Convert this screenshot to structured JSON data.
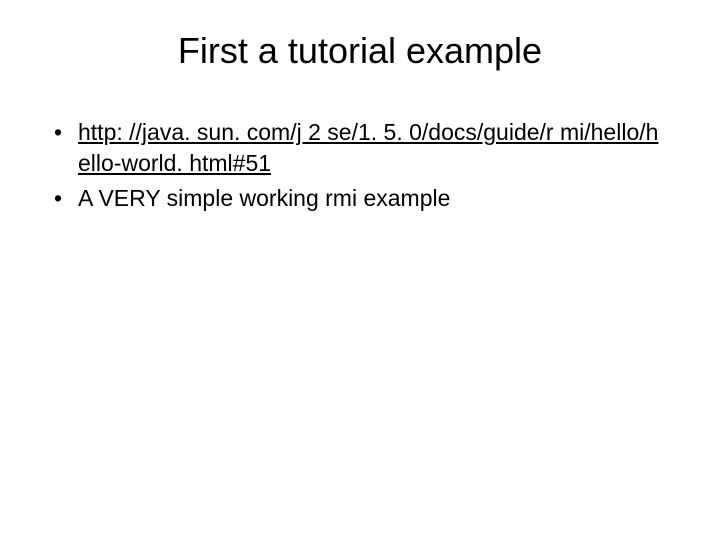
{
  "title": "First a tutorial example",
  "bullets": [
    {
      "type": "link",
      "text": "http: //java. sun. com/j 2 se/1. 5. 0/docs/guide/r mi/hello/hello-world. html#51"
    },
    {
      "type": "text",
      "text": "A VERY simple working rmi example"
    }
  ]
}
